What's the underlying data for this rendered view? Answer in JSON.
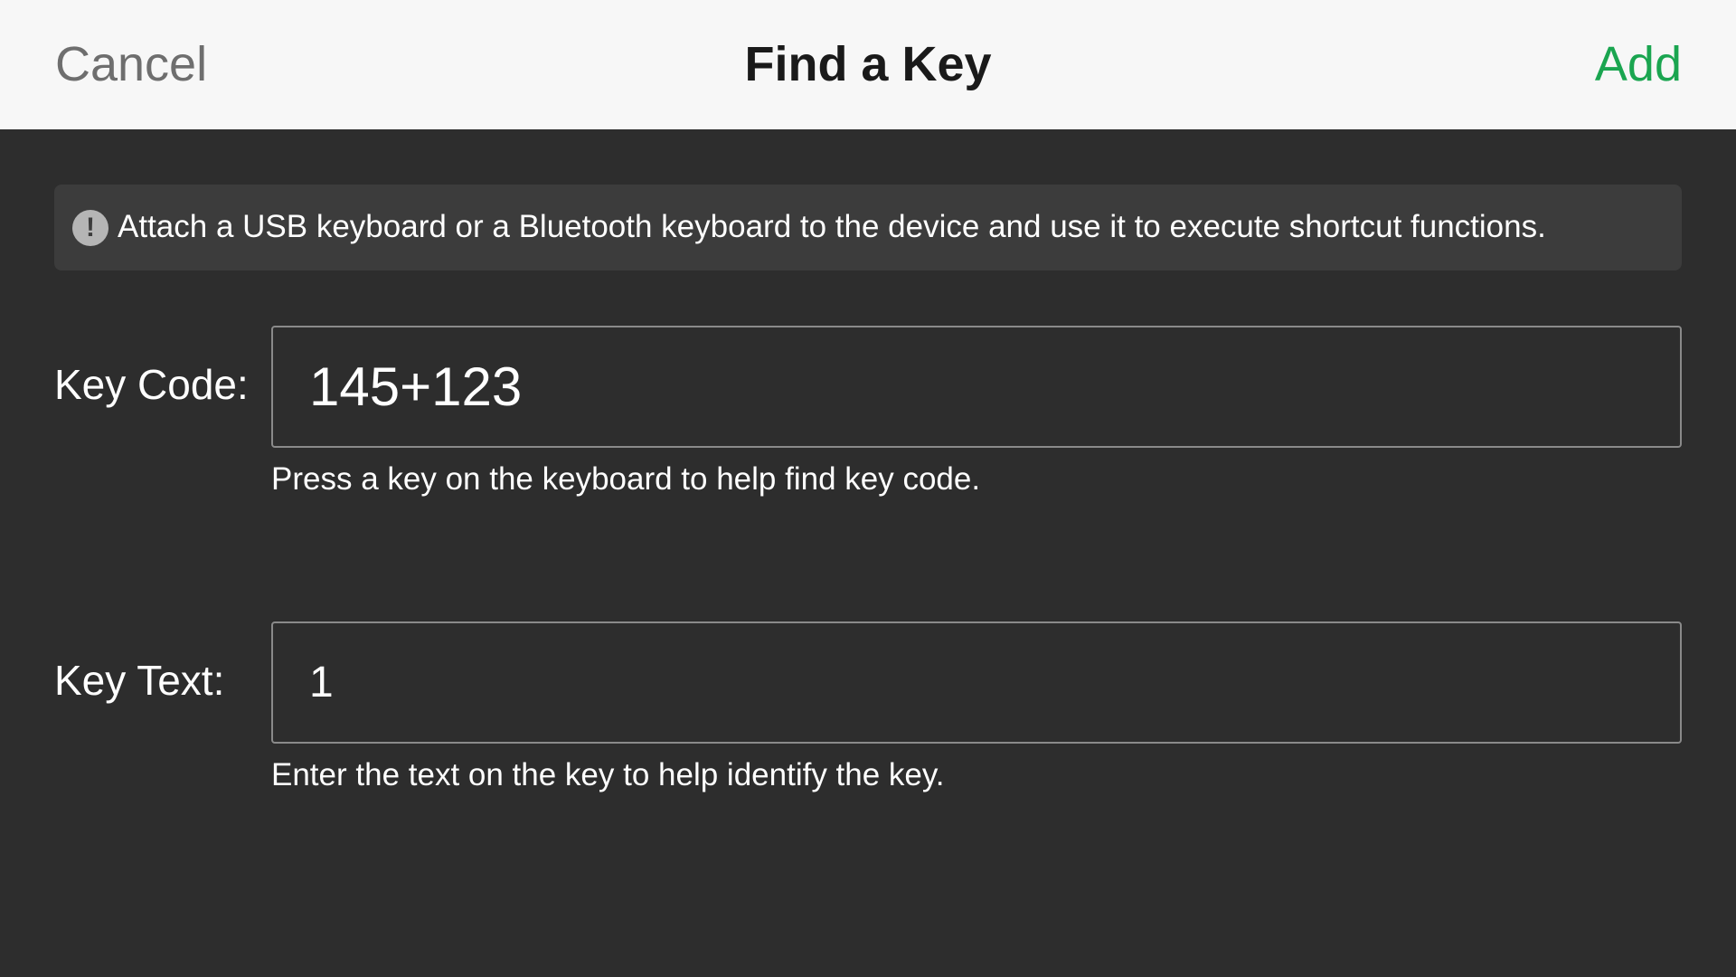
{
  "header": {
    "cancel_label": "Cancel",
    "title": "Find a Key",
    "add_label": "Add"
  },
  "notice": {
    "icon": "exclamation-circle-icon",
    "icon_glyph": "!",
    "text": "Attach a USB keyboard or a Bluetooth keyboard to the device and use it to execute shortcut functions."
  },
  "key_code": {
    "label": "Key Code:",
    "value": "145+123",
    "hint": "Press a key on the keyboard to help find key code."
  },
  "key_text": {
    "label": "Key Text:",
    "value": "1",
    "hint": "Enter the text on the key to help identify the key."
  },
  "colors": {
    "header_bg": "#f7f7f7",
    "body_bg": "#2d2d2d",
    "notice_bg": "#3c3c3c",
    "accent": "#1aa550",
    "cancel": "#6e6e6e"
  }
}
